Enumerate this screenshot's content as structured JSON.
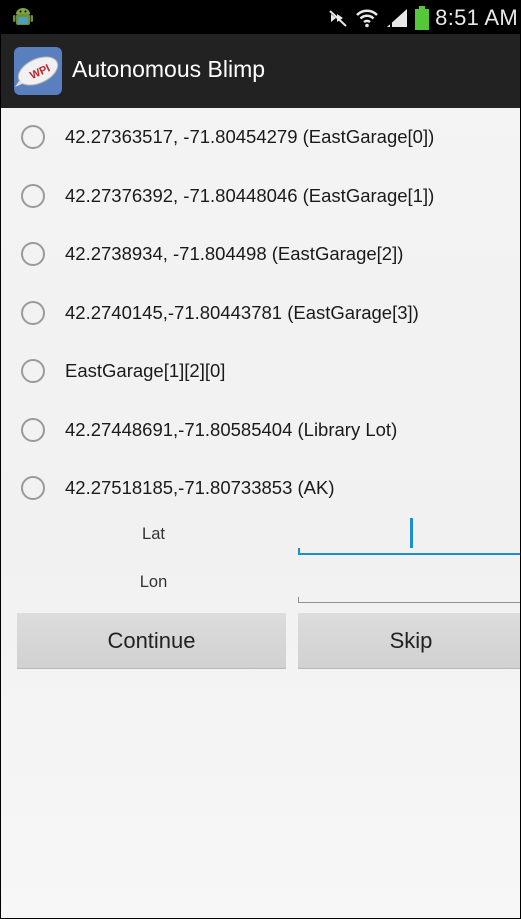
{
  "status_bar": {
    "time": "8:51 AM",
    "left_icon": "android-robot-icon",
    "icons": [
      "mute-icon",
      "wifi-icon",
      "signal-icon",
      "battery-icon"
    ]
  },
  "app_bar": {
    "title": "Autonomous Blimp",
    "icon": "blimp-app-icon",
    "icon_text": "WPI"
  },
  "locations": [
    {
      "label": "42.27363517, -71.80454279 (EastGarage[0])",
      "selected": false
    },
    {
      "label": "42.27376392, -71.80448046 (EastGarage[1])",
      "selected": false
    },
    {
      "label": "42.2738934, -71.804498 (EastGarage[2])",
      "selected": false
    },
    {
      "label": "42.2740145,-71.80443781 (EastGarage[3])",
      "selected": false
    },
    {
      "label": "EastGarage[1][2][0]",
      "selected": false
    },
    {
      "label": "42.27448691,-71.80585404 (Library Lot)",
      "selected": false
    },
    {
      "label": "42.27518185,-71.80733853 (AK)",
      "selected": false
    }
  ],
  "form": {
    "lat_label": "Lat",
    "lat_value": "",
    "lon_label": "Lon",
    "lon_value": ""
  },
  "buttons": {
    "continue": "Continue",
    "skip": "Skip"
  },
  "colors": {
    "status_bar_bg": "#000000",
    "action_bar_bg": "#222222",
    "accent_blue": "#1c8fd1",
    "battery_green": "#55c83a",
    "button_bg": "#d6d6d6",
    "background": "#f2f2f2"
  }
}
